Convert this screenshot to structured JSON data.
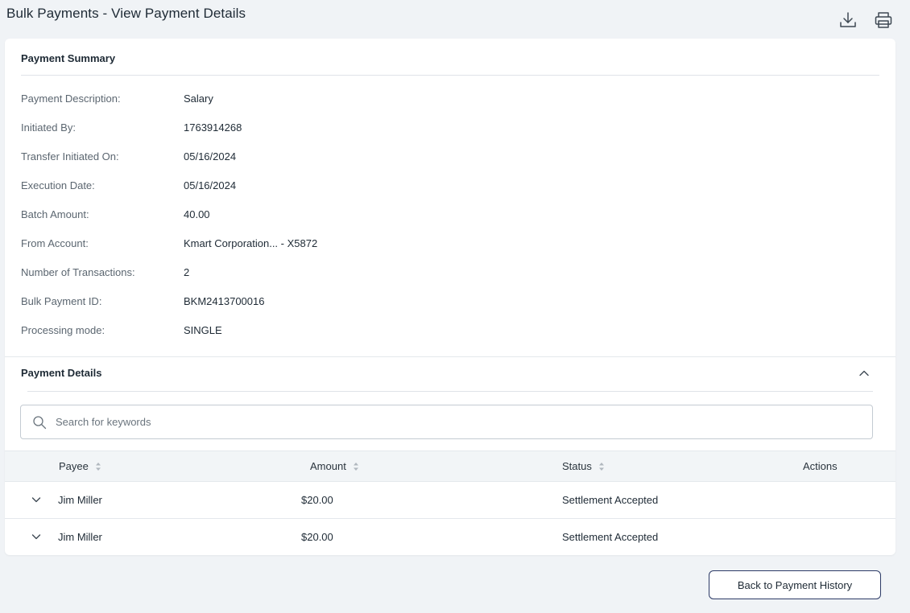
{
  "page": {
    "title": "Bulk Payments - View Payment Details"
  },
  "toolbar": {
    "download_icon": "download-icon",
    "print_icon": "print-icon"
  },
  "summary": {
    "title": "Payment Summary",
    "rows": [
      {
        "label": "Payment Description:",
        "value": "Salary"
      },
      {
        "label": "Initiated By:",
        "value": "1763914268"
      },
      {
        "label": "Transfer Initiated On:",
        "value": "05/16/2024"
      },
      {
        "label": "Execution Date:",
        "value": "05/16/2024"
      },
      {
        "label": "Batch Amount:",
        "value": "40.00"
      },
      {
        "label": "From Account:",
        "value": "Kmart Corporation... - X5872"
      },
      {
        "label": "Number of Transactions:",
        "value": "2"
      },
      {
        "label": "Bulk Payment ID:",
        "value": "BKM2413700016"
      },
      {
        "label": "Processing mode:",
        "value": "SINGLE"
      }
    ]
  },
  "details": {
    "title": "Payment Details",
    "search": {
      "placeholder": "Search for keywords",
      "value": ""
    },
    "columns": {
      "payee": "Payee",
      "amount": "Amount",
      "status": "Status",
      "actions": "Actions"
    },
    "rows": [
      {
        "payee": "Jim Miller",
        "amount": "$20.00",
        "status": "Settlement Accepted"
      },
      {
        "payee": "Jim Miller",
        "amount": "$20.00",
        "status": "Settlement Accepted"
      }
    ]
  },
  "footer": {
    "back_label": "Back to Payment History"
  },
  "colors": {
    "accent_border": "#2c3a66",
    "page_bg": "#f0f3f6",
    "header_bg": "#f2f5f7"
  }
}
